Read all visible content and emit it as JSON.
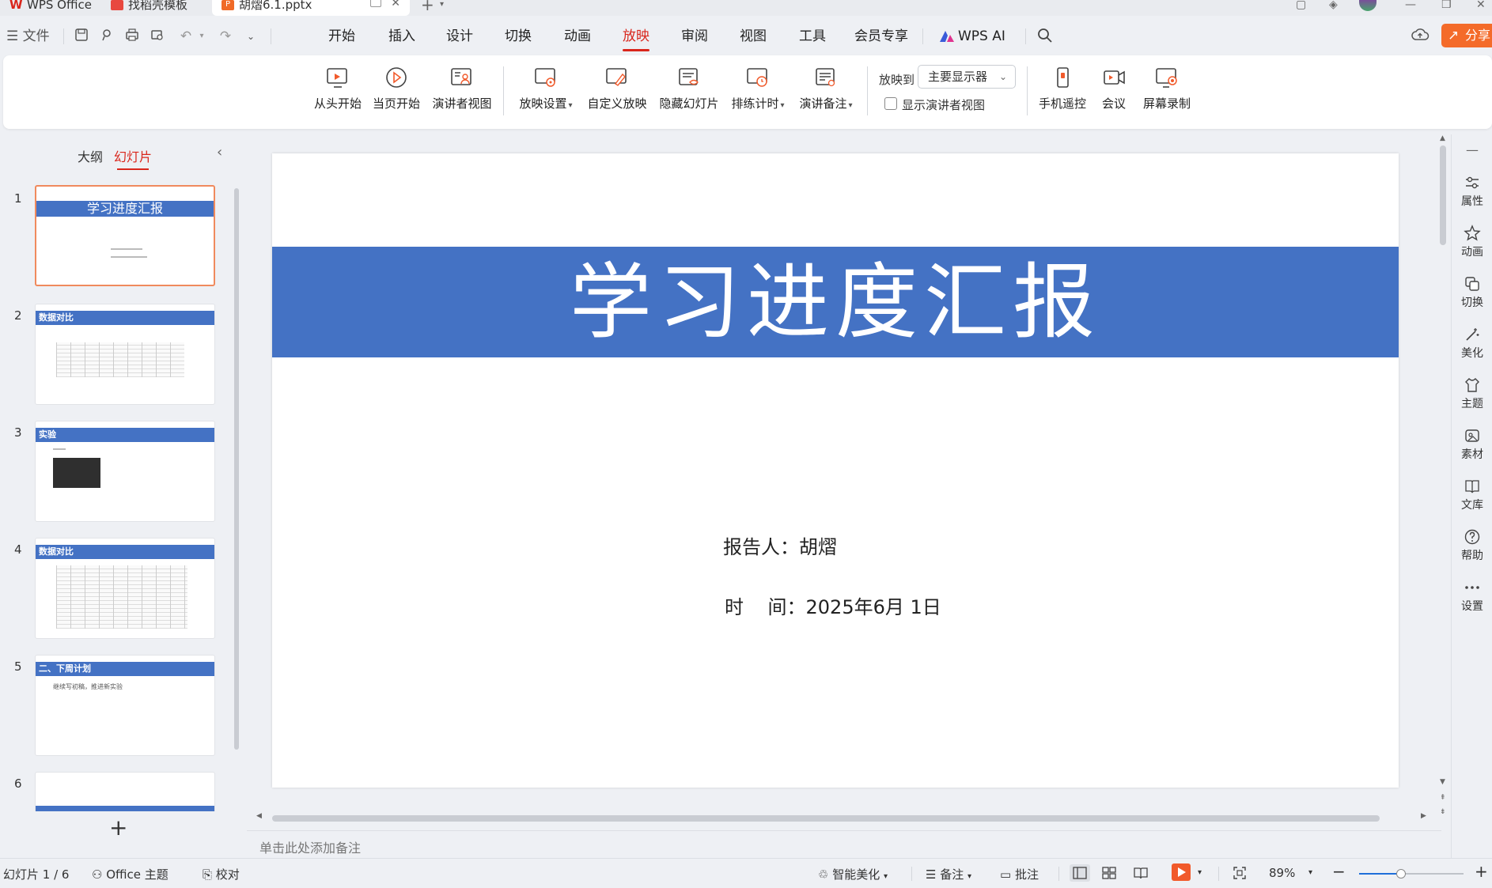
{
  "tabs": [
    {
      "label": "WPS Office",
      "color": "#d9261c"
    },
    {
      "label": "找稻壳模板",
      "color": "#e8483f"
    },
    {
      "label": "胡熠6.1.pptx",
      "color": "#f06a27"
    }
  ],
  "menu": {
    "file_label": "文件",
    "items": [
      "开始",
      "插入",
      "设计",
      "切换",
      "动画",
      "放映",
      "审阅",
      "视图",
      "工具",
      "会员专享",
      "WPS AI"
    ],
    "active": "放映",
    "share_label": "分享"
  },
  "ribbon": {
    "from_start": "从头开始",
    "from_current": "当页开始",
    "presenter_view": "演讲者视图",
    "slideshow_settings": "放映设置",
    "custom_show": "自定义放映",
    "hide_slide": "隐藏幻灯片",
    "rehearse_timings": "排练计时",
    "speaker_notes": "演讲备注",
    "present_to_label": "放映到",
    "present_to_value": "主要显示器",
    "show_presenter_view": "显示演讲者视图",
    "phone_remote": "手机遥控",
    "meeting": "会议",
    "screen_record": "屏幕录制"
  },
  "left_panel": {
    "tab_outline": "大纲",
    "tab_slides": "幻灯片",
    "slides": [
      {
        "num": "1",
        "title": "学习进度汇报",
        "selected": true
      },
      {
        "num": "2",
        "title": "数据对比"
      },
      {
        "num": "3",
        "title": "实验"
      },
      {
        "num": "4",
        "title": "数据对比"
      },
      {
        "num": "5",
        "title": "二、下周计划",
        "body": "继续写初稿，推进新实验"
      },
      {
        "num": "6",
        "title": ""
      }
    ],
    "add_label": "+"
  },
  "slide": {
    "title": "学习进度汇报",
    "reporter": "报告人：胡熠",
    "date": "时    间：2025年6月 1日",
    "accent": "#4472c4"
  },
  "notes_placeholder": "单击此处添加备注",
  "right_sidebar": [
    "属性",
    "动画",
    "切换",
    "美化",
    "主题",
    "素材",
    "文库",
    "帮助",
    "设置"
  ],
  "status": {
    "slide_counter": "幻灯片 1 / 6",
    "theme": "Office 主题",
    "proofread": "校对",
    "smart_beautify": "智能美化",
    "notes": "备注",
    "comments": "批注",
    "zoom": "89%",
    "zoom_level": 0.4
  }
}
